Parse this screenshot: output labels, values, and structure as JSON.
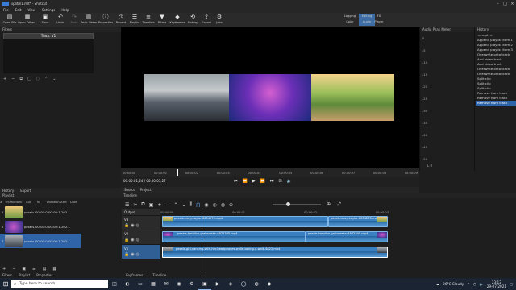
{
  "window": {
    "title": "splitm1.mlt* - Shotcut"
  },
  "menu": [
    "File",
    "Edit",
    "View",
    "Settings",
    "Help"
  ],
  "toolbar": {
    "buttons": [
      {
        "label": "Open File",
        "icon": "open-file-icon"
      },
      {
        "label": "Open Other...",
        "icon": "open-other-icon"
      },
      {
        "label": "Save",
        "icon": "save-icon"
      },
      {
        "label": "Undo",
        "icon": "undo-icon"
      },
      {
        "label": "Redo",
        "icon": "redo-icon"
      },
      {
        "label": "Peak Meter",
        "icon": "peak-meter-icon"
      },
      {
        "label": "Properties",
        "icon": "properties-icon"
      },
      {
        "label": "Recent",
        "icon": "recent-icon"
      },
      {
        "label": "Playlist",
        "icon": "playlist-icon"
      },
      {
        "label": "Timeline",
        "icon": "timeline-icon"
      },
      {
        "label": "Filters",
        "icon": "filters-icon"
      },
      {
        "label": "Keyframes",
        "icon": "keyframes-icon"
      },
      {
        "label": "History",
        "icon": "history-icon"
      },
      {
        "label": "Export",
        "icon": "export-icon"
      },
      {
        "label": "Jobs",
        "icon": "jobs-icon"
      }
    ],
    "layouts": [
      {
        "label": "Logging",
        "sub": "Color"
      },
      {
        "label": "Editing",
        "sub": "Audio"
      },
      {
        "label": "FX",
        "sub": "Player"
      }
    ]
  },
  "filters": {
    "title": "Filters",
    "track": "Track: V1"
  },
  "preview": {
    "ruler": [
      "00:00:00",
      "00:00:01",
      "00:00:02",
      "00:00:03",
      "00:00:04",
      "00:00:05",
      "00:00:06",
      "00:00:07",
      "00:00:08",
      "00:00:09"
    ],
    "current_time": "00:00:01;24",
    "total_time": "00:00:05;27",
    "tabs": [
      "Source",
      "Project"
    ]
  },
  "audio_meter": {
    "title": "Audio Peak Meter",
    "scale": [
      "0",
      "-5",
      "-10",
      "-15",
      "-20",
      "-25",
      "-30",
      "-35",
      "-40",
      "-45",
      "-50"
    ],
    "channels": "L R"
  },
  "history": {
    "title": "History",
    "items": [
      "<empty>",
      "Append playlist item 1",
      "Append playlist item 2",
      "Append playlist item 3",
      "Overwrite onto track",
      "Add video track",
      "Add video track",
      "Overwrite onto track",
      "Overwrite onto track",
      "Split clip",
      "Split clip",
      "Split clip",
      "Remove from track",
      "Remove from track",
      "Remove from track"
    ],
    "selected_index": 14
  },
  "left_tabs": [
    "History",
    "Export"
  ],
  "playlist": {
    "title": "Playlist",
    "columns": [
      "#",
      "Thumbnails",
      "Clip",
      "In",
      "Duration",
      "Start",
      "Date"
    ],
    "rows": [
      {
        "num": "1",
        "clip": "pexels...",
        "in": "00:00:0...",
        "duration": "00:00:1...",
        "start": "00:00:0...",
        "date": "202...\n18:..."
      },
      {
        "num": "2",
        "clip": "pexels...",
        "in": "00:00:0...",
        "duration": "00:00:1...",
        "start": "00:00:1...",
        "date": "202...\n18:..."
      },
      {
        "num": "3",
        "clip": "pexels...",
        "in": "00:00:0...",
        "duration": "00:00:1...",
        "start": "00:00:2...",
        "date": "202...\n18:..."
      }
    ],
    "selected_row": 2,
    "bottom_tabs": [
      "Filters",
      "Playlist",
      "Properties"
    ]
  },
  "timeline": {
    "title": "Timeline",
    "ruler": [
      "00:00:00",
      "00:00:01",
      "00:00:02",
      "00:00:03"
    ],
    "tracks": [
      {
        "name": "Output"
      },
      {
        "name": "V3"
      },
      {
        "name": "V2"
      },
      {
        "name": "V1"
      }
    ],
    "clips": [
      {
        "track": "V3",
        "label": "pexels-mary-taylor-6004270.mp4"
      },
      {
        "track": "V3b",
        "label": "pexels-mary-taylor-6004270.mp4"
      },
      {
        "track": "V2",
        "label": "pexels-karolina-grabowska-4672345.mp4"
      },
      {
        "track": "V2b",
        "label": "pexels-karolina-grabowska-4672345.mp4"
      },
      {
        "track": "V1",
        "label": "pexels-girl-dancing-with-her-headphones-while-taking-a-walk-4822.mp4"
      }
    ],
    "bottom_tabs": [
      "Keyframes",
      "Timeline"
    ]
  },
  "taskbar": {
    "search": "Type here to search",
    "weather": "26°C  Cloudy",
    "time": "23:12",
    "date": "29-07-2021"
  },
  "colors": {
    "accent": "#2f65a8",
    "clip": "#3a7fc0"
  }
}
